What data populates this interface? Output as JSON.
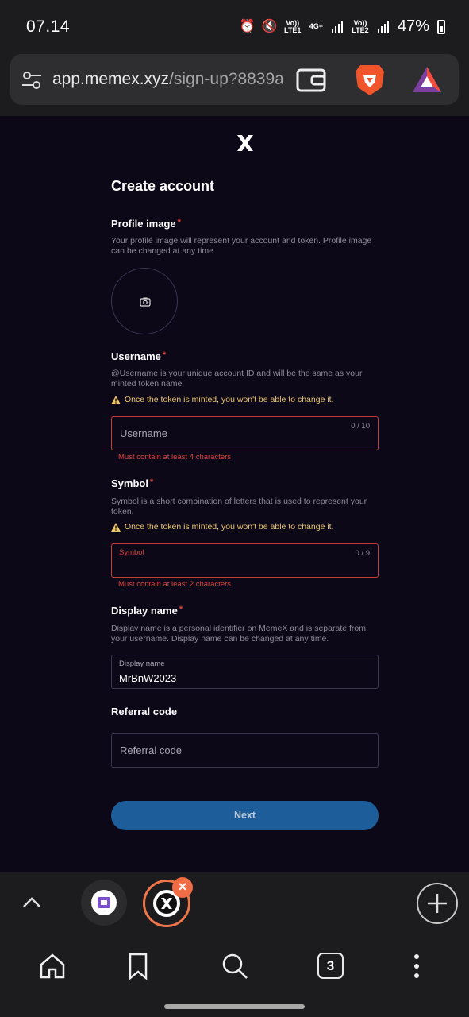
{
  "status_bar": {
    "time": "07.14",
    "net1": "Vo)) LTE1",
    "net_type": "4G+",
    "net2": "Vo)) LTE2",
    "battery": "47%",
    "icons": [
      "alarm-icon",
      "mute-icon",
      "signal-icon",
      "battery-icon"
    ]
  },
  "browser": {
    "url_host": "app.memex.xyz",
    "url_path": "/sign-up?8839a",
    "icons": [
      "tune-icon",
      "wallet-icon",
      "brave-lion-icon",
      "brave-rewards-icon"
    ]
  },
  "form": {
    "title": "Create account",
    "profile_image": {
      "label": "Profile image",
      "required": "*",
      "description": "Your profile image will represent your account and token. Profile image can be changed at any time."
    },
    "username": {
      "label": "Username",
      "required": "*",
      "description": "@Username is your unique account ID and will be the same as your minted token name.",
      "warning": "Once the token is minted, you won't be able to change it.",
      "placeholder": "Username",
      "counter": "0 / 10",
      "error": "Must contain at least 4 characters"
    },
    "symbol": {
      "label": "Symbol",
      "required": "*",
      "description": "Symbol is a short combination of letters that is used to represent your token.",
      "warning": "Once the token is minted, you won't be able to change it.",
      "field_label": "Symbol",
      "counter": "0 / 9",
      "error": "Must contain at least 2 characters"
    },
    "display_name": {
      "label": "Display name",
      "required": "*",
      "description": "Display name is a personal identifier on MemeX and is separate from your username. Display name can be changed at any time.",
      "field_label": "Display name",
      "value": "MrBnW2023"
    },
    "referral": {
      "label": "Referral code",
      "placeholder": "Referral code"
    },
    "next_label": "Next"
  },
  "tabs": {
    "close": "×",
    "count": "3"
  },
  "colors": {
    "page_bg": "#0d0818",
    "error": "#d9433e",
    "warning": "#e8c46a",
    "button": "#1d5d9a",
    "tab_accent": "#f06c45"
  }
}
